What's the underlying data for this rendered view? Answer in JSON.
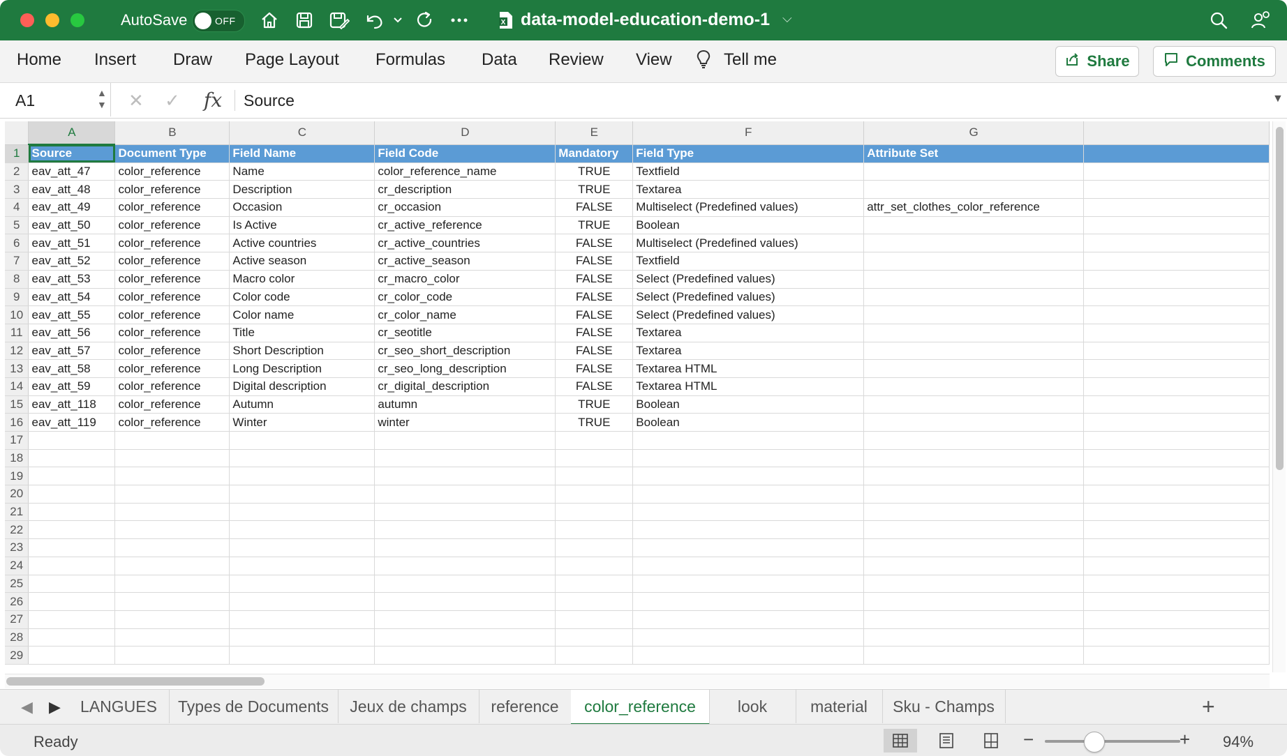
{
  "titlebar": {
    "autosave_label": "AutoSave",
    "autosave_state": "OFF",
    "document_title": "data-model-education-demo-1",
    "brand_color": "#1f7a3f"
  },
  "ribbon": {
    "tabs": [
      "Home",
      "Insert",
      "Draw",
      "Page Layout",
      "Formulas",
      "Data",
      "Review",
      "View"
    ],
    "tell_me": "Tell me",
    "share_label": "Share",
    "comments_label": "Comments"
  },
  "formula_bar": {
    "name_box": "A1",
    "value": "Source"
  },
  "grid": {
    "columns": [
      "A",
      "B",
      "C",
      "D",
      "E",
      "F",
      "G"
    ],
    "header_color": "#5b9bd5",
    "header_row": [
      "Source",
      "Document Type",
      "Field Name",
      "Field Code",
      "Mandatory",
      "Field Type",
      "Attribute Set"
    ],
    "rows": [
      [
        "eav_att_47",
        "color_reference",
        "Name",
        "color_reference_name",
        "TRUE",
        "Textfield",
        ""
      ],
      [
        "eav_att_48",
        "color_reference",
        "Description",
        "cr_description",
        "TRUE",
        "Textarea",
        ""
      ],
      [
        "eav_att_49",
        "color_reference",
        "Occasion",
        "cr_occasion",
        "FALSE",
        "Multiselect (Predefined values)",
        "attr_set_clothes_color_reference"
      ],
      [
        "eav_att_50",
        "color_reference",
        "Is Active",
        "cr_active_reference",
        "TRUE",
        "Boolean",
        ""
      ],
      [
        "eav_att_51",
        "color_reference",
        "Active countries",
        "cr_active_countries",
        "FALSE",
        "Multiselect (Predefined values)",
        ""
      ],
      [
        "eav_att_52",
        "color_reference",
        "Active season",
        "cr_active_season",
        "FALSE",
        "Textfield",
        ""
      ],
      [
        "eav_att_53",
        "color_reference",
        "Macro color",
        "cr_macro_color",
        "FALSE",
        "Select (Predefined values)",
        ""
      ],
      [
        "eav_att_54",
        "color_reference",
        "Color code",
        "cr_color_code",
        "FALSE",
        "Select (Predefined values)",
        ""
      ],
      [
        "eav_att_55",
        "color_reference",
        "Color name",
        "cr_color_name",
        "FALSE",
        "Select (Predefined values)",
        ""
      ],
      [
        "eav_att_56",
        "color_reference",
        "Title",
        "cr_seotitle",
        "FALSE",
        "Textarea",
        ""
      ],
      [
        "eav_att_57",
        "color_reference",
        "Short Description",
        "cr_seo_short_description",
        "FALSE",
        "Textarea",
        ""
      ],
      [
        "eav_att_58",
        "color_reference",
        "Long Description",
        "cr_seo_long_description",
        "FALSE",
        "Textarea HTML",
        ""
      ],
      [
        "eav_att_59",
        "color_reference",
        "Digital description",
        "cr_digital_description",
        "FALSE",
        "Textarea HTML",
        ""
      ],
      [
        "eav_att_118",
        "color_reference",
        "Autumn",
        "autumn",
        "TRUE",
        "Boolean",
        ""
      ],
      [
        "eav_att_119",
        "color_reference",
        "Winter",
        "winter",
        "TRUE",
        "Boolean",
        ""
      ]
    ],
    "row_numbers": [
      "1",
      "2",
      "3",
      "4",
      "5",
      "6",
      "7",
      "8",
      "9",
      "10",
      "11",
      "12",
      "13",
      "14",
      "15",
      "16",
      "17",
      "18",
      "19",
      "20",
      "21",
      "22",
      "23",
      "24",
      "25",
      "26",
      "27",
      "28",
      "29"
    ]
  },
  "sheet_tabs": {
    "tabs": [
      "LANGUES",
      "Types de Documents",
      "Jeux de champs",
      "reference",
      "color_reference",
      "look",
      "material",
      "Sku - Champs"
    ],
    "active": "color_reference"
  },
  "statusbar": {
    "status": "Ready",
    "zoom": "94%",
    "zoom_fraction": 0.36
  }
}
